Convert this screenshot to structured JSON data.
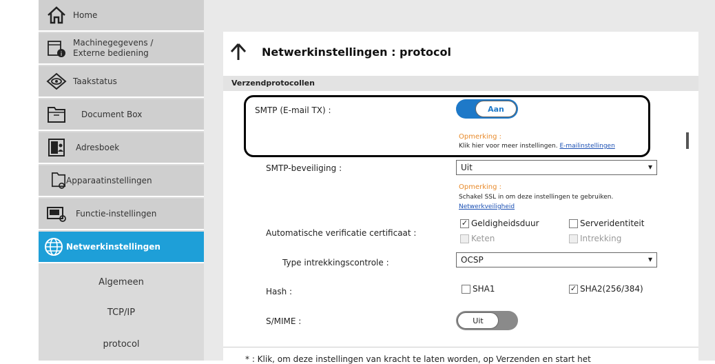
{
  "sidebar": {
    "items": [
      {
        "label": "Home",
        "icon": "home-icon"
      },
      {
        "label": "Machinegegevens /\nExterne bediening",
        "icon": "device-info-icon"
      },
      {
        "label": "Taakstatus",
        "icon": "eye-icon"
      },
      {
        "label": "Document Box",
        "icon": "folder-icon"
      },
      {
        "label": "Adresboek",
        "icon": "address-book-icon"
      },
      {
        "label": "Apparaatinstellingen",
        "icon": "device-settings-icon"
      },
      {
        "label": "Functie-instellingen",
        "icon": "function-settings-icon"
      },
      {
        "label": "Netwerkinstellingen",
        "icon": "globe-icon",
        "active": true
      }
    ],
    "sub_items": [
      "Algemeen",
      "TCP/IP",
      "protocol"
    ]
  },
  "page": {
    "title": "Netwerkinstellingen : protocol",
    "section": "Verzendprotocollen"
  },
  "smtp": {
    "label": "SMTP (E-mail TX) :",
    "toggle": "Aan",
    "note_title": "Opmerking :",
    "note_text": "Klik hier voor meer instellingen.",
    "note_link": "E-mailinstellingen"
  },
  "smtp_security": {
    "label": "SMTP-beveiliging :",
    "value": "Uit",
    "note_title": "Opmerking :",
    "note_text": "Schakel SSL in om deze instellingen te gebruiken.",
    "note_link": "Netwerkveiligheid"
  },
  "cert": {
    "label": "Automatische verificatie certificaat :",
    "options": [
      {
        "label": "Geldigheidsduur",
        "checked": true,
        "disabled": false
      },
      {
        "label": "Serveridentiteit",
        "checked": false,
        "disabled": false
      },
      {
        "label": "Keten",
        "checked": false,
        "disabled": true
      },
      {
        "label": "Intrekking",
        "checked": false,
        "disabled": true
      }
    ]
  },
  "revocation": {
    "label": "Type intrekkingscontrole :",
    "value": "OCSP"
  },
  "hash": {
    "label": "Hash :",
    "options": [
      {
        "label": "SHA1",
        "checked": false
      },
      {
        "label": "SHA2(256/384)",
        "checked": true
      }
    ]
  },
  "smime": {
    "label": "S/MIME :",
    "toggle": "Uit"
  },
  "footer": {
    "note": "* : Klik, om deze instellingen van kracht te laten worden, op Verzenden en start het"
  },
  "colors": {
    "accent": "#1e9fd8",
    "toggle_on": "#1e79c8",
    "note": "#e88a2a"
  }
}
